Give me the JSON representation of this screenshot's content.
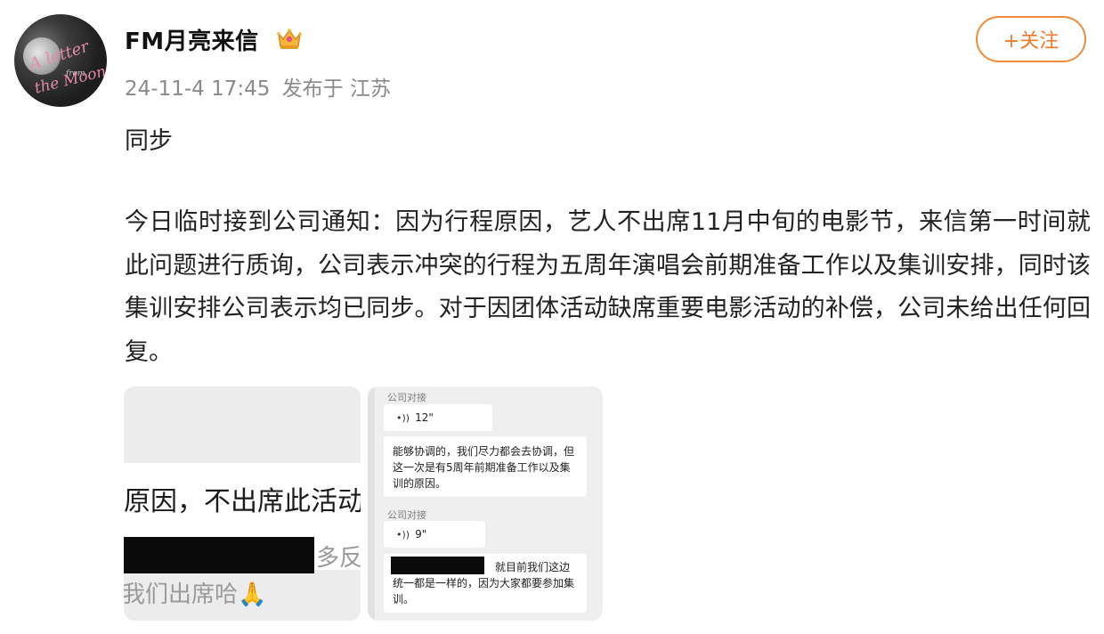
{
  "post": {
    "username": "FM月亮来信",
    "timestamp": "24-11-4 17:45",
    "source": "发布于 江苏",
    "follow_label": "+关注",
    "first_line": "同步",
    "body": "今日临时接到公司通知：因为行程原因，艺人不出席11月中旬的电影节，来信第一时间就此问题进行质询，公司表示冲突的行程为五周年演唱会前期准备工作以及集训安排，同时该集训安排公司表示均已同步。对于因团体活动缺席重要电影活动的补偿，公司未给出任何回复。"
  },
  "avatar": {
    "script1": "A letter",
    "script2": "from",
    "script3": "the Moon"
  },
  "image1": {
    "text1": "原因，不出席此活动",
    "text2": "多反",
    "text3": "我们出席哈🙏"
  },
  "image2": {
    "label1": "公司对接",
    "voice1": "12\"",
    "message1": "能够协调的，我们尽力都会去协调，但这一次是有5周年前期准备工作以及集训的原因。",
    "label2": "公司对接",
    "voice2": "9\"",
    "message2": "就目前我们这边统一都是一样的，因为大家都要参加集训。"
  },
  "colors": {
    "accent": "#f07a2a",
    "meta": "#8a8a8a"
  }
}
